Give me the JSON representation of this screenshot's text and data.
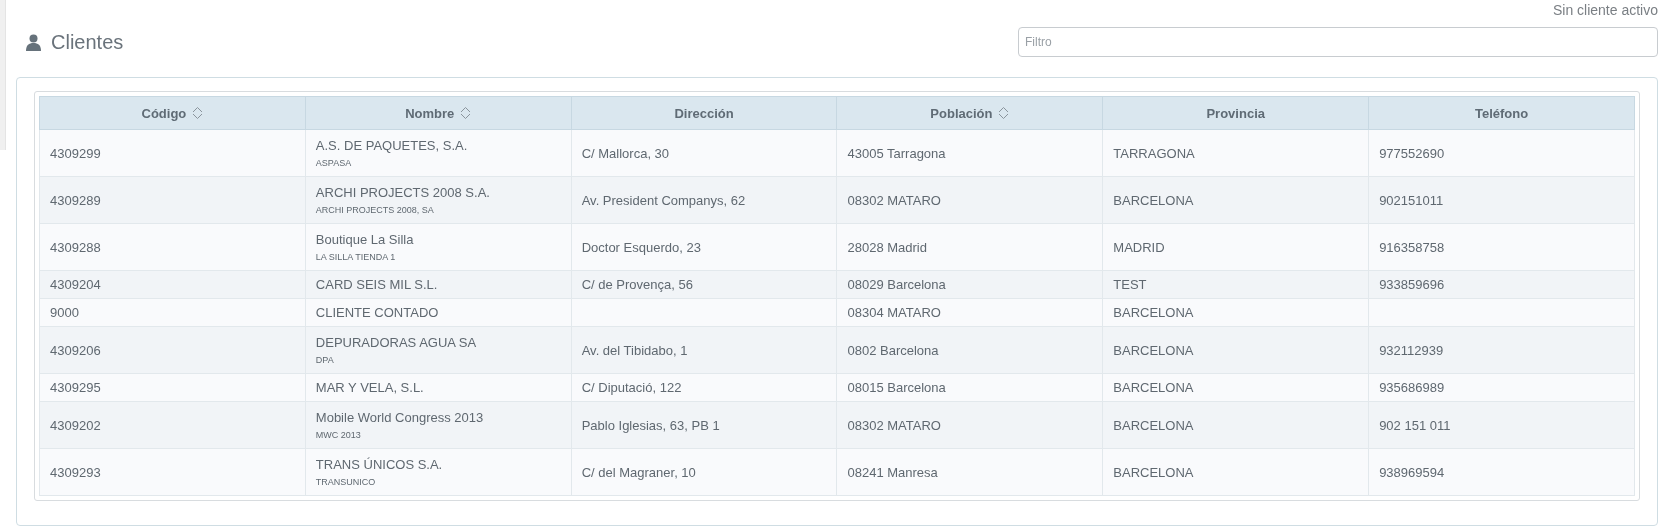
{
  "status": "Sin cliente activo",
  "header": {
    "title": "Clientes"
  },
  "filter": {
    "placeholder": "Filtro"
  },
  "table": {
    "columns": [
      {
        "label": "Código",
        "sortable": true
      },
      {
        "label": "Nombre",
        "sortable": true
      },
      {
        "label": "Dirección",
        "sortable": false
      },
      {
        "label": "Población",
        "sortable": true
      },
      {
        "label": "Provincia",
        "sortable": false
      },
      {
        "label": "Teléfono",
        "sortable": false
      }
    ],
    "rows": [
      {
        "codigo": "4309299",
        "nombre": "A.S. DE PAQUETES, S.A.",
        "alias": "ASPASA",
        "direccion": "C/ Mallorca, 30",
        "poblacion": "43005 Tarragona",
        "provincia": "TARRAGONA",
        "telefono": "977552690"
      },
      {
        "codigo": "4309289",
        "nombre": "ARCHI PROJECTS 2008 S.A.",
        "alias": "ARCHI PROJECTS 2008, SA",
        "direccion": "Av. President Companys, 62",
        "poblacion": "08302 MATARO",
        "provincia": "BARCELONA",
        "telefono": "902151011"
      },
      {
        "codigo": "4309288",
        "nombre": "Boutique La Silla",
        "alias": "LA SILLA TIENDA 1",
        "direccion": "Doctor Esquerdo, 23",
        "poblacion": "28028 Madrid",
        "provincia": "MADRID",
        "telefono": "916358758"
      },
      {
        "codigo": "4309204",
        "nombre": "CARD SEIS MIL S.L.",
        "direccion": "C/ de Provença, 56",
        "poblacion": "08029 Barcelona",
        "provincia": "TEST",
        "telefono": "933859696"
      },
      {
        "codigo": "9000",
        "nombre": "CLIENTE CONTADO",
        "poblacion": "08304 MATARO",
        "provincia": "BARCELONA"
      },
      {
        "codigo": "4309206",
        "nombre": "DEPURADORAS AGUA SA",
        "alias": "DPA",
        "direccion": "Av. del Tibidabo, 1",
        "poblacion": "0802 Barcelona",
        "provincia": "BARCELONA",
        "telefono": "932112939"
      },
      {
        "codigo": "4309295",
        "nombre": "MAR Y VELA, S.L.",
        "direccion": "C/ Diputació, 122",
        "poblacion": "08015 Barcelona",
        "provincia": "BARCELONA",
        "telefono": "935686989"
      },
      {
        "codigo": "4309202",
        "nombre": "Mobile World Congress 2013",
        "alias": "MWC 2013",
        "direccion": "Pablo Iglesias, 63, PB 1",
        "poblacion": "08302 MATARO",
        "provincia": "BARCELONA",
        "telefono": "902 151 011"
      },
      {
        "codigo": "4309293",
        "nombre": "TRANS ÚNICOS S.A.",
        "alias": "TRANSUNICO",
        "direccion": "C/ del Magraner, 10",
        "poblacion": "08241 Manresa",
        "provincia": "BARCELONA",
        "telefono": "938969594"
      }
    ]
  }
}
